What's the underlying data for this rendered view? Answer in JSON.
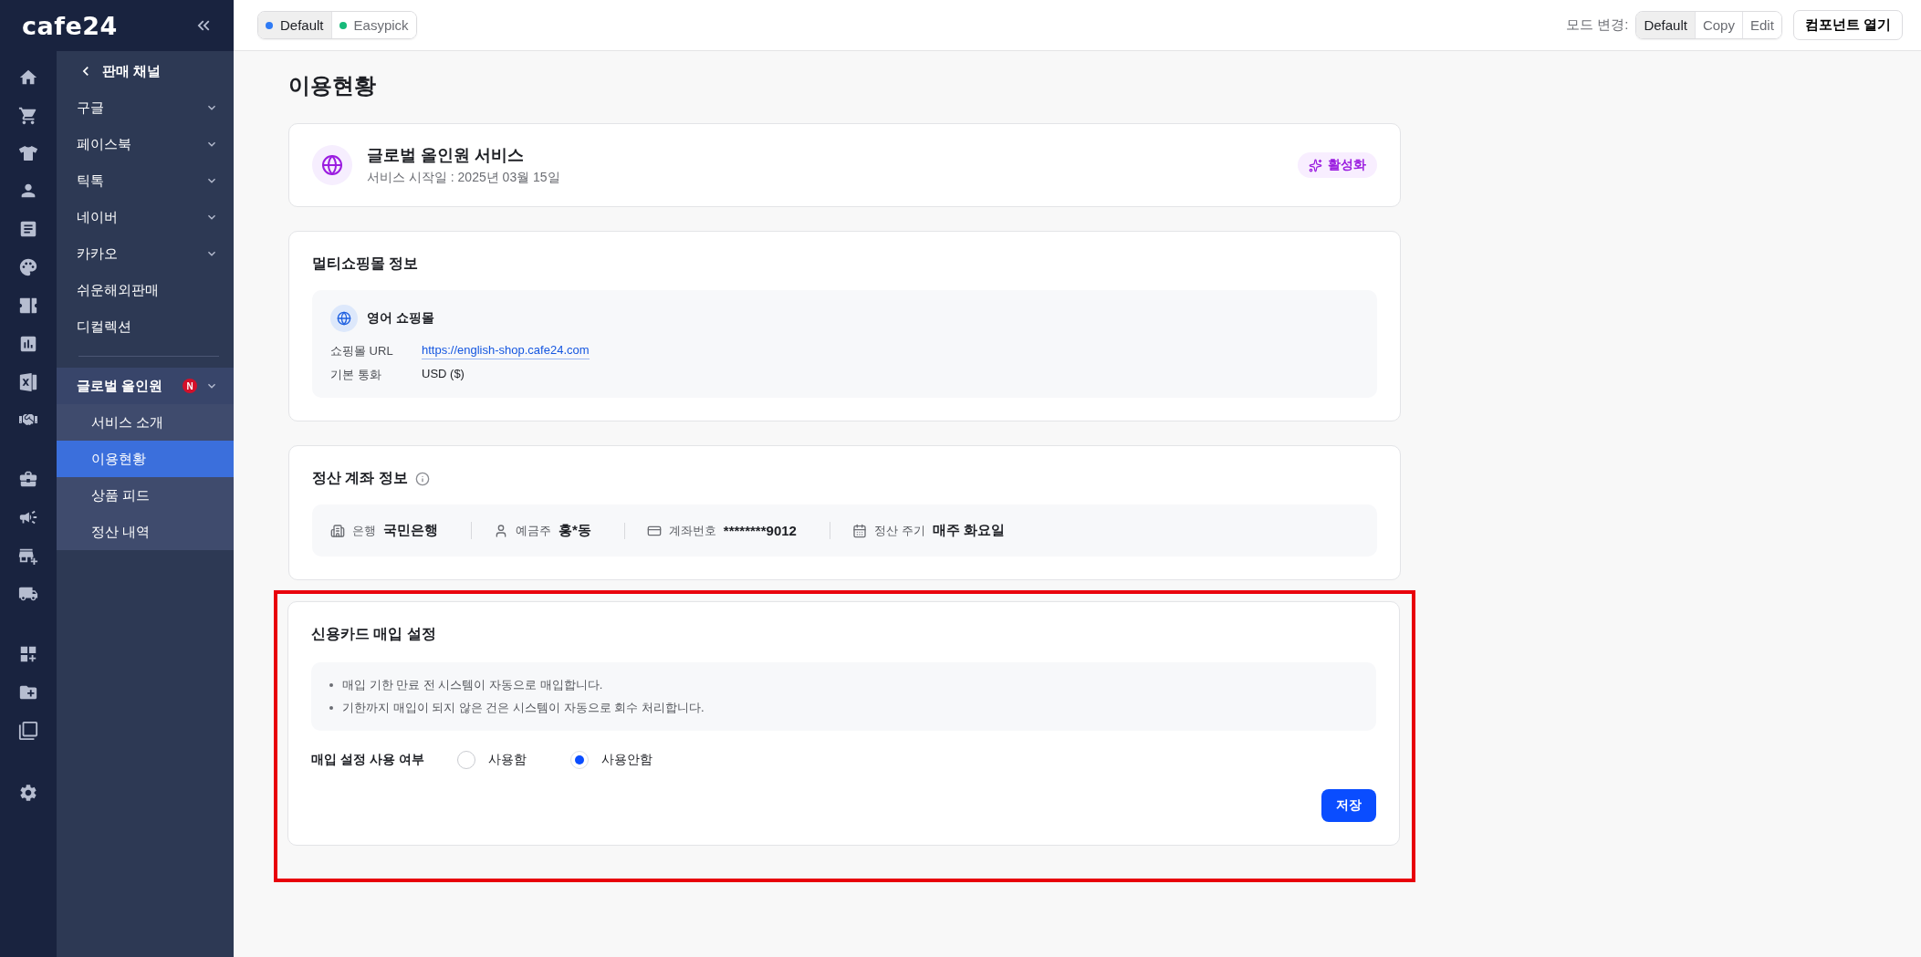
{
  "brand": "cafe24",
  "sidebar": {
    "back": "판매 채널",
    "items": [
      {
        "label": "구글",
        "kind": "group",
        "expanded": false
      },
      {
        "label": "페이스북",
        "kind": "group",
        "expanded": false
      },
      {
        "label": "틱톡",
        "kind": "group",
        "expanded": false
      },
      {
        "label": "네이버",
        "kind": "group",
        "expanded": false
      },
      {
        "label": "카카오",
        "kind": "group",
        "expanded": false
      },
      {
        "label": "쉬운해외판매",
        "kind": "link"
      },
      {
        "label": "디컬렉션",
        "kind": "link"
      },
      {
        "label": "글로벌 올인원",
        "kind": "group",
        "expanded": true,
        "badge": "N",
        "children": [
          {
            "label": "서비스 소개",
            "selected": false
          },
          {
            "label": "이용현황",
            "selected": true
          },
          {
            "label": "상품 피드",
            "selected": false
          },
          {
            "label": "정산 내역",
            "selected": false
          }
        ]
      }
    ]
  },
  "topbar": {
    "env_tabs": [
      {
        "label": "Default",
        "selected": true,
        "color": "#2f7bf5"
      },
      {
        "label": "Easypick",
        "selected": false,
        "color": "#16b979"
      }
    ],
    "mode_label": "모드 변경:",
    "modes": [
      {
        "label": "Default",
        "selected": true
      },
      {
        "label": "Copy",
        "selected": false
      },
      {
        "label": "Edit",
        "selected": false
      }
    ],
    "open_button": "컴포넌트 열기"
  },
  "page_title": "이용현황",
  "service": {
    "title": "글로벌 올인원 서비스",
    "subtitle": "서비스 시작일 : 2025년 03월 15일",
    "status": "활성화"
  },
  "multishop": {
    "title": "멀티쇼핑몰 정보",
    "shop_name": "영어 쇼핑몰",
    "fields": [
      {
        "label": "쇼핑몰 URL",
        "value": "https://english-shop.cafe24.com",
        "kind": "link"
      },
      {
        "label": "기본 통화",
        "value": "USD ($)",
        "kind": "text"
      }
    ]
  },
  "account": {
    "title": "정산 계좌 정보",
    "items": [
      {
        "kind": "bank",
        "label": "은행",
        "value": "국민은행"
      },
      {
        "kind": "person",
        "label": "예금주",
        "value": "홍*동"
      },
      {
        "kind": "card",
        "label": "계좌번호",
        "value": "********9012"
      },
      {
        "kind": "calendar",
        "label": "정산 주기",
        "value": "매주 화요일"
      }
    ]
  },
  "credit_card": {
    "highlighted": true,
    "title": "신용카드 매입 설정",
    "notes": [
      "매입 기한 만료 전 시스템이 자동으로 매입합니다.",
      "기한까지 매입이 되지 않은 건은 시스템이 자동으로 회수 처리합니다."
    ],
    "option_label": "매입 설정 사용 여부",
    "options": [
      {
        "label": "사용함",
        "selected": false
      },
      {
        "label": "사용안함",
        "selected": true
      }
    ],
    "save_button": "저장"
  }
}
